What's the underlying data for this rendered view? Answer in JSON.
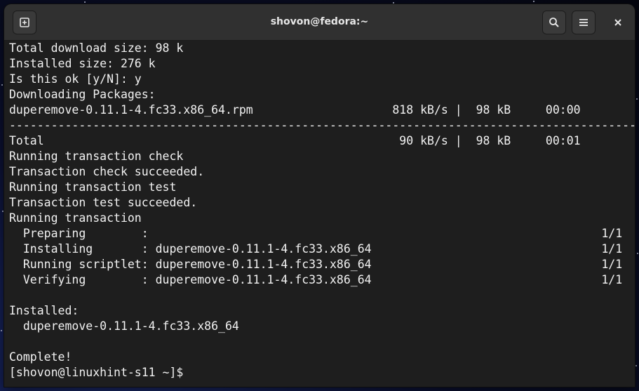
{
  "window": {
    "title": "shovon@fedora:~"
  },
  "headerbar": {
    "new_tab_icon": "new-tab-icon",
    "search_icon": "search-icon",
    "menu_icon": "hamburger-menu-icon",
    "close_icon": "close-icon"
  },
  "terminal": {
    "lines": [
      "Total download size: 98 k",
      "Installed size: 276 k",
      "Is this ok [y/N]: y",
      "Downloading Packages:",
      "duperemove-0.11.1-4.fc33.x86_64.rpm                    818 kB/s |  98 kB     00:00",
      "------------------------------------------------------------------------------------------",
      "Total                                                   90 kB/s |  98 kB     00:01",
      "Running transaction check",
      "Transaction check succeeded.",
      "Running transaction test",
      "Transaction test succeeded.",
      "Running transaction",
      "  Preparing        :                                                                 1/1",
      "  Installing       : duperemove-0.11.1-4.fc33.x86_64                                 1/1",
      "  Running scriptlet: duperemove-0.11.1-4.fc33.x86_64                                 1/1",
      "  Verifying        : duperemove-0.11.1-4.fc33.x86_64                                 1/1",
      "",
      "Installed:",
      "  duperemove-0.11.1-4.fc33.x86_64",
      "",
      "Complete!",
      "[shovon@linuxhint-s11 ~]$ "
    ]
  }
}
